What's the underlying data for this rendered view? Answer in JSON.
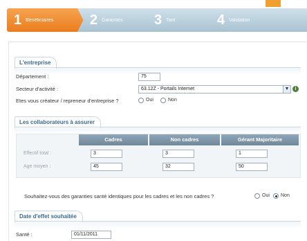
{
  "steps": [
    {
      "num": "1",
      "label": "Bénéficiaires"
    },
    {
      "num": "2",
      "label": "Garanties"
    },
    {
      "num": "3",
      "label": "Tarif"
    },
    {
      "num": "4",
      "label": "Validation"
    }
  ],
  "entreprise": {
    "title": "L'entreprise",
    "departement_label": "Département :",
    "departement_value": "75",
    "secteur_label": "Secteur d'activité :",
    "secteur_value": "63.12Z - Portails Internet",
    "createur_label": "Etes vous créateur / repreneur d'entreprise ?",
    "oui": "Oui",
    "non": "Non"
  },
  "collaborateurs": {
    "title": "Les collaborateurs à assurer",
    "columns": [
      "Cadres",
      "Non cadres",
      "Gérant Majoritaire"
    ],
    "rows": [
      {
        "label": "Effectif total :",
        "values": [
          "3",
          "3",
          "1"
        ]
      },
      {
        "label": "Age moyen :",
        "values": [
          "45",
          "32",
          "50"
        ]
      }
    ],
    "question": "Souhaitez-vous des garanties santé identiques pour les cadres et les non cadres ?",
    "oui": "Oui",
    "non": "Non",
    "selected": "Non"
  },
  "date_effet": {
    "title": "Date d'effet souhaitée",
    "sante_label": "Santé :",
    "sante_value": "01/11/2011"
  },
  "icons": {
    "info": "info-icon",
    "dropdown": "chevron-down-icon"
  },
  "colors": {
    "accent": "#ea7d1f",
    "section_title": "#3b6a8f",
    "table_header": "#7d95a8"
  }
}
